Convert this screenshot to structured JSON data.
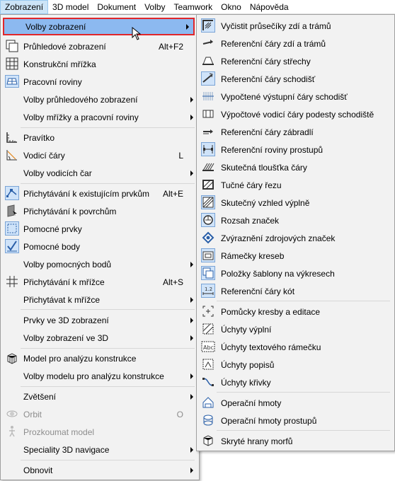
{
  "menubar": {
    "items": [
      "Zobrazení",
      "3D model",
      "Dokument",
      "Volby",
      "Teamwork",
      "Okno",
      "Nápověda"
    ]
  },
  "left_menu": {
    "items": [
      {
        "label": "Volby zobrazení",
        "shortcut": "",
        "submenu": true,
        "icon": "none"
      },
      {
        "label": "Průhledové zobrazení",
        "shortcut": "Alt+F2",
        "submenu": false,
        "icon": "trace-icon"
      },
      {
        "label": "Konstrukční mřížka",
        "shortcut": "",
        "submenu": false,
        "icon": "grid-icon"
      },
      {
        "label": "Pracovní roviny",
        "shortcut": "",
        "submenu": false,
        "icon": "plane-icon"
      },
      {
        "label": "Volby průhledového zobrazení",
        "shortcut": "",
        "submenu": true,
        "icon": "none"
      },
      {
        "label": "Volby mřížky a pracovní roviny",
        "shortcut": "",
        "submenu": true,
        "icon": "none"
      },
      {
        "label": "Pravítko",
        "shortcut": "",
        "submenu": false,
        "icon": "ruler-icon"
      },
      {
        "label": "Vodicí čáry",
        "shortcut": "L",
        "submenu": false,
        "icon": "guide-lines-icon"
      },
      {
        "label": "Volby vodicích čar",
        "shortcut": "",
        "submenu": true,
        "icon": "none"
      },
      {
        "label": "Přichytávání k existujícím prvkům",
        "shortcut": "Alt+E",
        "submenu": false,
        "icon": "snap-elements-icon"
      },
      {
        "label": "Přichytávání k povrchům",
        "shortcut": "",
        "submenu": false,
        "icon": "snap-surface-icon"
      },
      {
        "label": "Pomocné prvky",
        "shortcut": "",
        "submenu": false,
        "icon": "helper-elements-icon"
      },
      {
        "label": "Pomocné body",
        "shortcut": "",
        "submenu": false,
        "icon": "helper-points-icon"
      },
      {
        "label": "Volby pomocných bodů",
        "shortcut": "",
        "submenu": true,
        "icon": "none"
      },
      {
        "label": "Přichytávání k mřížce",
        "shortcut": "Alt+S",
        "submenu": false,
        "icon": "snap-grid-icon"
      },
      {
        "label": "Přichytávat k mřížce",
        "shortcut": "",
        "submenu": true,
        "icon": "none"
      },
      {
        "label": "Prvky ve 3D zobrazení",
        "shortcut": "",
        "submenu": true,
        "icon": "none"
      },
      {
        "label": "Volby zobrazení ve 3D",
        "shortcut": "",
        "submenu": true,
        "icon": "none"
      },
      {
        "label": "Model pro analýzu konstrukce",
        "shortcut": "",
        "submenu": false,
        "icon": "structural-model-icon"
      },
      {
        "label": "Volby modelu pro analýzu konstrukce",
        "shortcut": "",
        "submenu": true,
        "icon": "none"
      },
      {
        "label": "Zvětšení",
        "shortcut": "",
        "submenu": true,
        "icon": "none"
      },
      {
        "label": "Orbit",
        "shortcut": "O",
        "submenu": false,
        "icon": "orbit-icon",
        "disabled": true
      },
      {
        "label": "Prozkoumat model",
        "shortcut": "",
        "submenu": false,
        "icon": "explore-icon",
        "disabled": true
      },
      {
        "label": "Speciality 3D navigace",
        "shortcut": "",
        "submenu": true,
        "icon": "none"
      },
      {
        "label": "Obnovit",
        "shortcut": "",
        "submenu": true,
        "icon": "none"
      }
    ]
  },
  "right_menu": {
    "items": [
      {
        "label": "Vyčistit průsečíky zdí a trámů",
        "icon": "clean-intersections-icon"
      },
      {
        "label": "Referenční čáry zdí a trámů",
        "icon": "wall-ref-lines-icon"
      },
      {
        "label": "Referenční čáry střechy",
        "icon": "roof-ref-lines-icon"
      },
      {
        "label": "Referenční čáry schodišť",
        "icon": "stair-ref-lines-icon"
      },
      {
        "label": "Vypočtené výstupní čáry schodišť",
        "icon": "walkline-icon"
      },
      {
        "label": "Výpočtové vodicí čáry podesty schodiště",
        "icon": "landing-lines-icon"
      },
      {
        "label": "Referenční čáry zábradlí",
        "icon": "railing-ref-icon"
      },
      {
        "label": "Referenční roviny prostupů",
        "icon": "opening-planes-icon"
      },
      {
        "label": "Skutečná tloušťka čáry",
        "icon": "true-line-weight-icon"
      },
      {
        "label": "Tučné čáry řezu",
        "icon": "bold-cut-lines-icon"
      },
      {
        "label": "Skutečný vzhled výplně",
        "icon": "vectorial-hatching-icon"
      },
      {
        "label": "Rozsah značek",
        "icon": "marker-range-icon"
      },
      {
        "label": "Zvýraznění zdrojových značek",
        "icon": "highlight-markers-icon"
      },
      {
        "label": "Rámečky kreseb",
        "icon": "drawing-frames-icon"
      },
      {
        "label": "Položky šablony na výkresech",
        "icon": "master-items-icon"
      },
      {
        "label": "Referenční čáry kót",
        "icon": "dimension-ref-icon"
      },
      {
        "label": "Pomůcky kresby a editace",
        "icon": "drawing-aids-icon"
      },
      {
        "label": "Úchyty výplní",
        "icon": "fill-handles-icon"
      },
      {
        "label": "Úchyty textového rámečku",
        "icon": "text-handles-icon"
      },
      {
        "label": "Úchyty popisů",
        "icon": "label-handles-icon"
      },
      {
        "label": "Úchyty křivky",
        "icon": "curve-handles-icon"
      },
      {
        "label": "Operační hmoty",
        "icon": "operator-volumes-icon"
      },
      {
        "label": "Operační hmoty prostupů",
        "icon": "opening-operators-icon"
      },
      {
        "label": "Skryté hrany morfů",
        "icon": "morph-hidden-edges-icon"
      }
    ]
  }
}
